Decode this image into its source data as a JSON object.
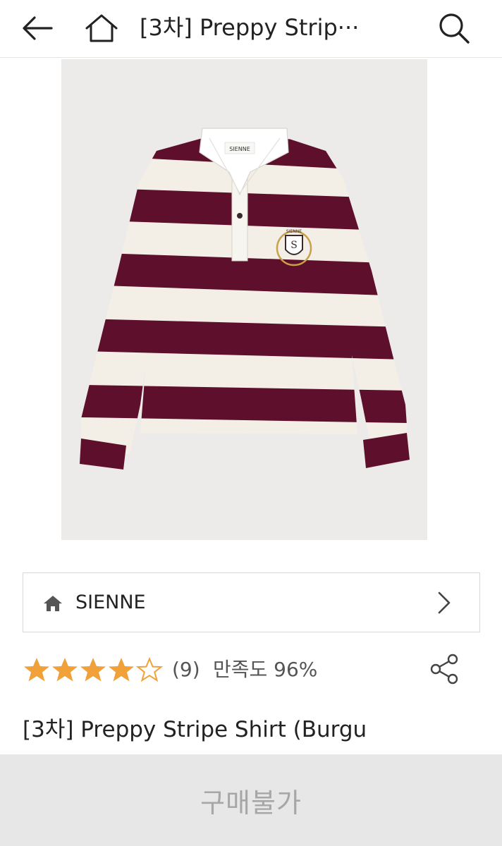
{
  "header": {
    "title": "[3차] Preppy Strip···",
    "icons": [
      "back-arrow-icon",
      "home-icon",
      "search-icon"
    ]
  },
  "product": {
    "image_alt": "burgundy and cream striped rugby polo shirt with white collar and crest logo",
    "image_brand_tag": "SIENNE",
    "crest_text": "SIENNE",
    "title": "[3차] Preppy Stripe Shirt (Burgu"
  },
  "brand": {
    "name": "SIENNE",
    "icons": [
      "home-icon",
      "chevron-right-icon"
    ]
  },
  "rating": {
    "stars": 4,
    "max_stars": 5,
    "review_count": "(9)",
    "satisfaction": "만족도 96%",
    "star_color": "#f0a13a"
  },
  "bottom": {
    "buy_label": "구매불가"
  },
  "colors": {
    "burgundy": "#5e0f2b",
    "cream": "#f3efe6",
    "bar_bg": "#e7e7e7",
    "disabled_text": "#a7a7a7"
  }
}
